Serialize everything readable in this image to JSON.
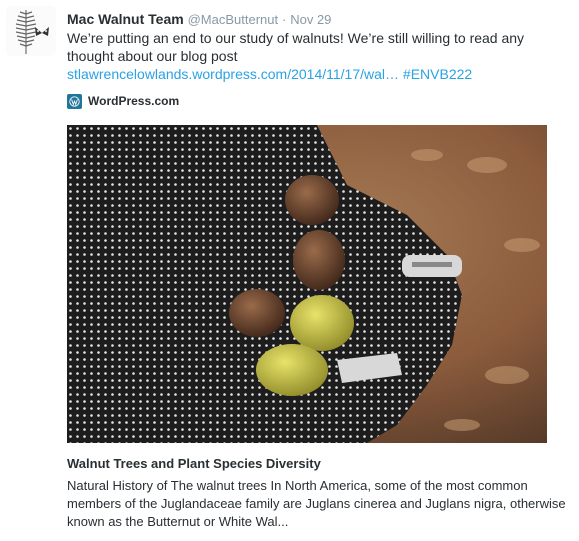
{
  "tweet": {
    "author_name": "Mac Walnut Team",
    "handle": "@MacButternut",
    "separator": "·",
    "timestamp": "Nov 29",
    "text_prefix": "We’re putting an end to our study of walnuts! We’re still willing to read any thought about our blog post ",
    "link_text": "stlawrencelowlands.wordpress.com/2014/11/17/wal…",
    "hashtag": "#ENVB222"
  },
  "card": {
    "source_icon": "wordpress-icon",
    "source_name": "WordPress.com",
    "image_alt": "gloved hand holding butternuts",
    "title": "Walnut Trees and Plant Species Diversity",
    "description": "Natural History of The walnut trees In North America, some of the most common members of the Juglandaceae family are Juglans cinerea and Juglans nigra, otherwise known as the Butternut or White Wal..."
  },
  "colors": {
    "link": "#2aa2e3",
    "text": "#292f33",
    "muted": "#8899a6",
    "wordpress": "#21759b"
  }
}
